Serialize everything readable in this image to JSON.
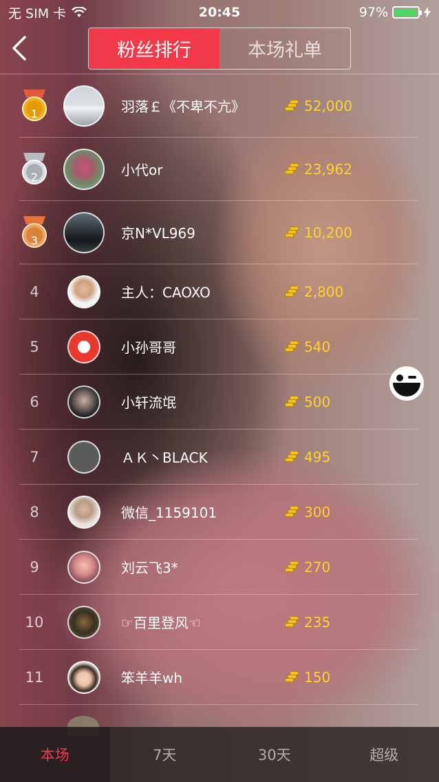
{
  "status_bar": {
    "carrier": "无 SIM 卡",
    "time": "20:45",
    "battery": "97%"
  },
  "header": {
    "tabs": [
      {
        "label": "粉丝排行",
        "active": true
      },
      {
        "label": "本场礼单",
        "active": false
      }
    ]
  },
  "colors": {
    "accent": "#f2394a",
    "coin_text": "#ffd230"
  },
  "ranking": [
    {
      "rank": "1",
      "medal": "gold",
      "name": "羽落￡《不卑不亢》",
      "coins": "52,000"
    },
    {
      "rank": "2",
      "medal": "silver",
      "name": "小代or",
      "coins": "23,962"
    },
    {
      "rank": "3",
      "medal": "bronze",
      "name": "京N*VL969",
      "coins": "10,200"
    },
    {
      "rank": "4",
      "medal": null,
      "name": "主人：CAOXO",
      "coins": "2,800"
    },
    {
      "rank": "5",
      "medal": null,
      "name": "小孙哥哥",
      "coins": "540"
    },
    {
      "rank": "6",
      "medal": null,
      "name": "小轩流氓",
      "coins": "500"
    },
    {
      "rank": "7",
      "medal": null,
      "name": "ＡＫ丶BLACK",
      "coins": "495"
    },
    {
      "rank": "8",
      "medal": null,
      "name": "微信_1159101",
      "coins": "300"
    },
    {
      "rank": "9",
      "medal": null,
      "name": "刘云飞3*",
      "coins": "270"
    },
    {
      "rank": "10",
      "medal": null,
      "name": "☞百里登风☜",
      "coins": "235"
    },
    {
      "rank": "11",
      "medal": null,
      "name": "笨羊羊wh",
      "coins": "150"
    }
  ],
  "bottom_tabs": [
    {
      "label": "本场",
      "active": true
    },
    {
      "label": "7天",
      "active": false
    },
    {
      "label": "30天",
      "active": false
    },
    {
      "label": "超级",
      "active": false
    }
  ]
}
